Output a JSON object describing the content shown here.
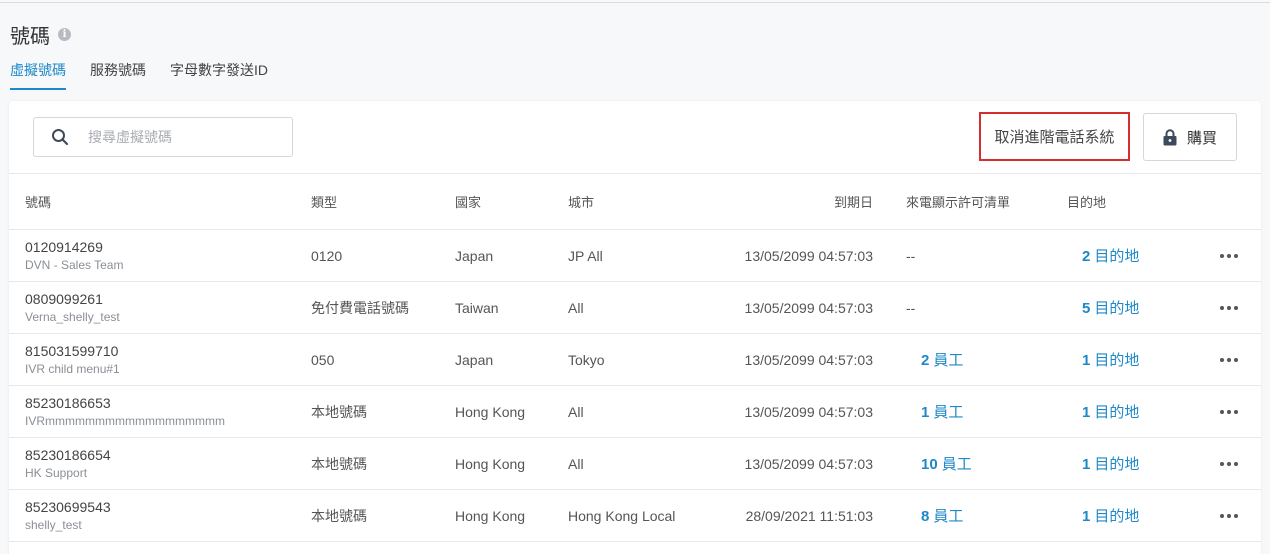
{
  "page": {
    "title": "號碼",
    "tabs": [
      {
        "label": "虛擬號碼",
        "active": true
      },
      {
        "label": "服務號碼",
        "active": false
      },
      {
        "label": "字母數字發送ID",
        "active": false
      }
    ]
  },
  "toolbar": {
    "search_placeholder": "搜尋虛擬號碼",
    "cancel_label": "取消進階電話系統",
    "buy_label": "購買"
  },
  "table": {
    "headers": {
      "number": "號碼",
      "type": "類型",
      "country": "國家",
      "city": "城市",
      "expiry": "到期日",
      "caller": "來電顯示許可清單",
      "destination": "目的地"
    },
    "rows": [
      {
        "number": "0120914269",
        "sub": "DVN - Sales Team",
        "type": "0120",
        "country": "Japan",
        "city": "JP All",
        "expiry": "13/05/2099 04:57:03",
        "caller_text": "--",
        "caller_count": "",
        "caller_unit": "",
        "dest_count": "2",
        "dest_unit": "目的地"
      },
      {
        "number": "0809099261",
        "sub": "Verna_shelly_test",
        "type": "免付費電話號碼",
        "country": "Taiwan",
        "city": "All",
        "expiry": "13/05/2099 04:57:03",
        "caller_text": "--",
        "caller_count": "",
        "caller_unit": "",
        "dest_count": "5",
        "dest_unit": "目的地"
      },
      {
        "number": "815031599710",
        "sub": "IVR child menu#1",
        "type": "050",
        "country": "Japan",
        "city": "Tokyo",
        "expiry": "13/05/2099 04:57:03",
        "caller_text": "",
        "caller_count": "2",
        "caller_unit": "員工",
        "dest_count": "1",
        "dest_unit": "目的地"
      },
      {
        "number": "85230186653",
        "sub": "IVRmmmmmmmmmmmmmmmmmm",
        "type": "本地號碼",
        "country": "Hong Kong",
        "city": "All",
        "expiry": "13/05/2099 04:57:03",
        "caller_text": "",
        "caller_count": "1",
        "caller_unit": "員工",
        "dest_count": "1",
        "dest_unit": "目的地"
      },
      {
        "number": "85230186654",
        "sub": "HK Support",
        "type": "本地號碼",
        "country": "Hong Kong",
        "city": "All",
        "expiry": "13/05/2099 04:57:03",
        "caller_text": "",
        "caller_count": "10",
        "caller_unit": "員工",
        "dest_count": "1",
        "dest_unit": "目的地"
      },
      {
        "number": "85230699543",
        "sub": "shelly_test",
        "type": "本地號碼",
        "country": "Hong Kong",
        "city": "Hong Kong Local",
        "expiry": "28/09/2021 11:51:03",
        "caller_text": "",
        "caller_count": "8",
        "caller_unit": "員工",
        "dest_count": "1",
        "dest_unit": "目的地"
      }
    ]
  },
  "colors": {
    "accent": "#1e88c8",
    "highlight_border": "#d32f2f"
  }
}
